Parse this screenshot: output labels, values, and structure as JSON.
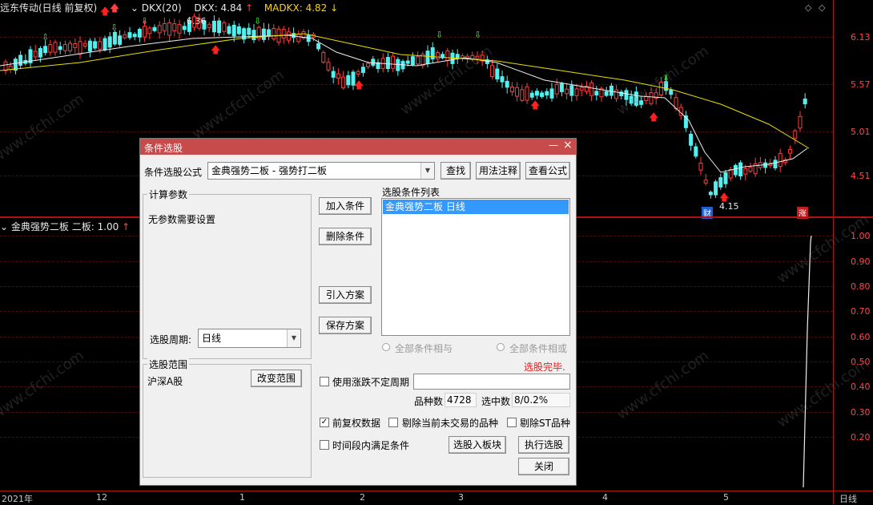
{
  "header": {
    "stock": "远东传动(日线 前复权)",
    "indicator": "DKX(20)",
    "dkx_label": "DKX: 4.84",
    "madkx_label": "MADKX: 4.82"
  },
  "chart": {
    "price_axis": [
      "6.13",
      "5.57",
      "5.01",
      "4.51"
    ],
    "high_label": "6.36",
    "low_label": "4.15",
    "cai_badge": "财",
    "zhang_badge": "涨"
  },
  "sub_chart": {
    "title": "金典强势二板 二板: 1.00",
    "axis": [
      "1.00",
      "0.90",
      "0.80",
      "0.70",
      "0.60",
      "0.50",
      "0.40",
      "0.30",
      "0.20"
    ]
  },
  "x_axis": {
    "dates": [
      "2021年",
      "12",
      "1",
      "2",
      "3",
      "4",
      "5"
    ],
    "period": "日线"
  },
  "dialog": {
    "title": "条件选股",
    "minimize": "—",
    "close": "×",
    "formula_label": "条件选股公式",
    "formula_value": "金典强势二板 - 强势打二板",
    "find_btn": "查找",
    "usage_btn": "用法注释",
    "view_btn": "查看公式",
    "params_group": "计算参数",
    "params_text": "无参数需要设置",
    "period_label": "选股周期:",
    "period_value": "日线",
    "scope_group": "选股范围",
    "scope_value": "沪深A股",
    "change_scope_btn": "改变范围",
    "add_btn": "加入条件",
    "del_btn": "删除条件",
    "import_btn": "引入方案",
    "save_btn": "保存方案",
    "list_label": "选股条件列表",
    "list_items": [
      "金典强势二板  日线"
    ],
    "radio_and": "全部条件相与",
    "radio_or": "全部条件相或",
    "status": "选股完毕.",
    "uncertain_label": "使用涨跌不定周期",
    "count_label": "品种数",
    "count_value": "4728",
    "selected_label": "选中数",
    "selected_value": "8/0.2%",
    "adjust_label": "前复权数据",
    "exclude_suspended_label": "剔除当前未交易的品种",
    "exclude_st_label": "剔除ST品种",
    "timespan_label": "时间段内满足条件",
    "to_block_btn": "选股入板块",
    "execute_btn": "执行选股",
    "close_btn": "关闭"
  },
  "watermark": "www.cfchi.com",
  "colors": {
    "up": "#ff3c3c",
    "down": "#54f0f0",
    "dkx": "#f0f0f0",
    "madkx": "#e8e000",
    "title_bar": "#c74b4b"
  }
}
